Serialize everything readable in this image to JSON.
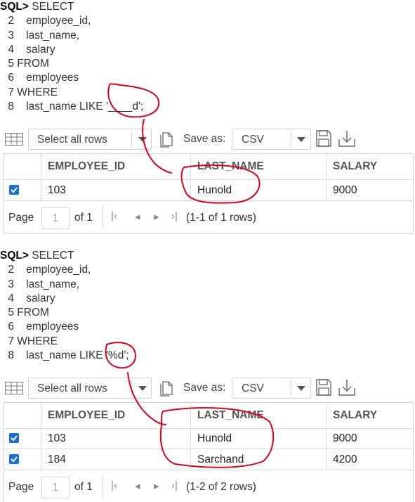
{
  "panels": [
    {
      "sql_lines": [
        {
          "num": "SQL>",
          "text": " SELECT"
        },
        {
          "num": "2",
          "text": "    employee_id,"
        },
        {
          "num": "3",
          "text": "    last_name,"
        },
        {
          "num": "4",
          "text": "    salary"
        },
        {
          "num": "5",
          "text": " FROM"
        },
        {
          "num": "6",
          "text": "    employees"
        },
        {
          "num": "7",
          "text": " WHERE"
        },
        {
          "num": "8",
          "text": "    last_name LIKE '____d';"
        }
      ],
      "toolbar": {
        "rows_select": "Select all rows",
        "save_as_label": "Save as:",
        "format": "CSV"
      },
      "columns": [
        "EMPLOYEE_ID",
        "LAST_NAME",
        "SALARY"
      ],
      "rows": [
        {
          "employee_id": "103",
          "last_name": "Hunold",
          "salary": "9000",
          "checked": true
        }
      ],
      "pager": {
        "page_label": "Page",
        "page_value": "1",
        "of_label": "of 1",
        "summary": "(1-1 of 1 rows)"
      }
    },
    {
      "sql_lines": [
        {
          "num": "SQL>",
          "text": " SELECT"
        },
        {
          "num": "2",
          "text": "    employee_id,"
        },
        {
          "num": "3",
          "text": "    last_name,"
        },
        {
          "num": "4",
          "text": "    salary"
        },
        {
          "num": "5",
          "text": " FROM"
        },
        {
          "num": "6",
          "text": "    employees"
        },
        {
          "num": "7",
          "text": " WHERE"
        },
        {
          "num": "8",
          "text": "    last_name LIKE '%d';"
        }
      ],
      "toolbar": {
        "rows_select": "Select all rows",
        "save_as_label": "Save as:",
        "format": "CSV"
      },
      "columns": [
        "EMPLOYEE_ID",
        "LAST_NAME",
        "SALARY"
      ],
      "rows": [
        {
          "employee_id": "103",
          "last_name": "Hunold",
          "salary": "9000",
          "checked": true
        },
        {
          "employee_id": "184",
          "last_name": "Sarchand",
          "salary": "4200",
          "checked": true
        }
      ],
      "pager": {
        "page_label": "Page",
        "page_value": "1",
        "of_label": "of 1",
        "summary": "(1-2 of 2 rows)"
      }
    }
  ],
  "colors": {
    "checkbox": "#1a6fd6",
    "annotation": "#e0001a"
  },
  "icons": [
    "grid-icon",
    "chevron-down-icon",
    "document-icon",
    "floppy-disk-icon",
    "download-icon",
    "first-page-icon",
    "prev-page-icon",
    "next-page-icon",
    "last-page-icon",
    "checkmark-icon"
  ]
}
